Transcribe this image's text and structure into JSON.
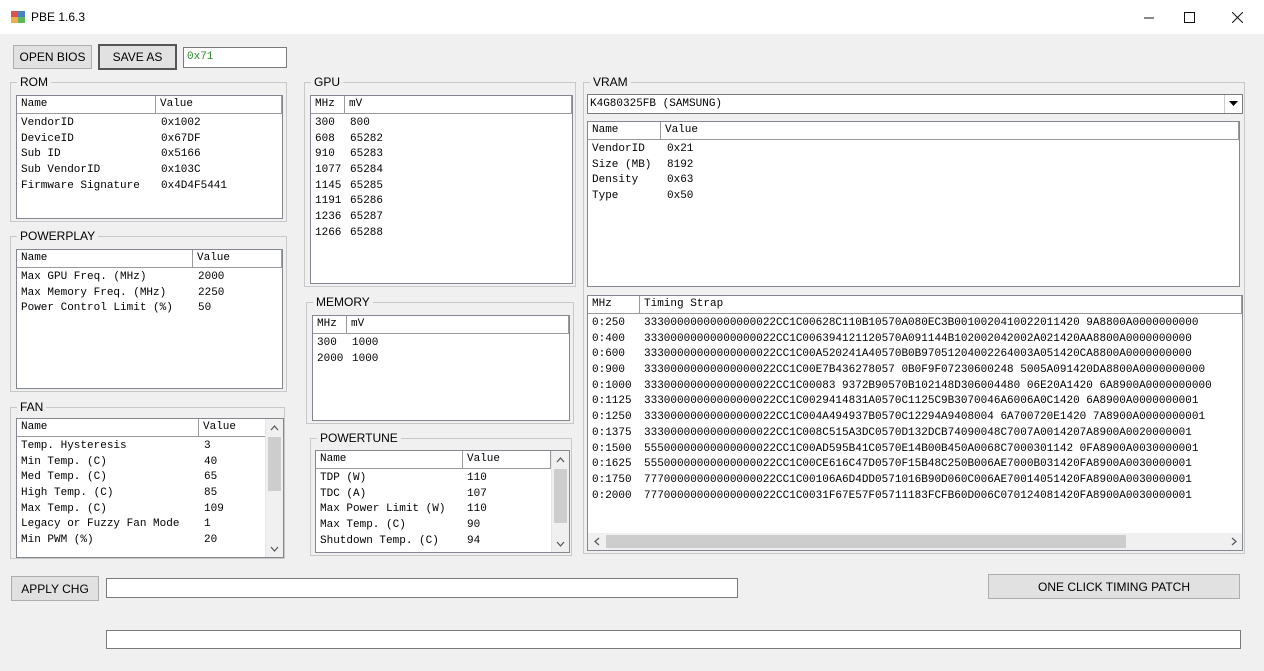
{
  "window": {
    "title": "PBE 1.6.3",
    "minimize": "—",
    "maximize": "☐",
    "close": "✕"
  },
  "toolbar": {
    "open_bios": "OPEN BIOS",
    "save_as": "SAVE AS",
    "hex_value": "0x71"
  },
  "rom": {
    "title": "ROM",
    "columns": [
      "Name",
      "Value"
    ],
    "rows": [
      [
        "VendorID",
        "0x1002"
      ],
      [
        "DeviceID",
        "0x67DF"
      ],
      [
        "Sub ID",
        "0x5166"
      ],
      [
        "Sub VendorID",
        "0x103C"
      ],
      [
        "Firmware Signature",
        "0x4D4F5441"
      ]
    ]
  },
  "powerplay": {
    "title": "POWERPLAY",
    "columns": [
      "Name",
      "Value"
    ],
    "rows": [
      [
        "Max GPU Freq. (MHz)",
        "2000"
      ],
      [
        "Max Memory Freq. (MHz)",
        "2250"
      ],
      [
        "Power Control Limit (%)",
        "50"
      ]
    ]
  },
  "fan": {
    "title": "FAN",
    "columns": [
      "Name",
      "Value"
    ],
    "rows": [
      [
        "Temp. Hysteresis",
        "3"
      ],
      [
        "Min Temp. (C)",
        "40"
      ],
      [
        "Med Temp. (C)",
        "65"
      ],
      [
        "High Temp. (C)",
        "85"
      ],
      [
        "Max Temp. (C)",
        "109"
      ],
      [
        "Legacy or Fuzzy Fan Mode",
        "1"
      ],
      [
        "Min PWM (%)",
        "20"
      ]
    ]
  },
  "gpu": {
    "title": "GPU",
    "columns": [
      "MHz",
      "mV"
    ],
    "rows": [
      [
        "300",
        "800"
      ],
      [
        "608",
        "65282"
      ],
      [
        "910",
        "65283"
      ],
      [
        "1077",
        "65284"
      ],
      [
        "1145",
        "65285"
      ],
      [
        "1191",
        "65286"
      ],
      [
        "1236",
        "65287"
      ],
      [
        "1266",
        "65288"
      ]
    ]
  },
  "memory": {
    "title": "MEMORY",
    "columns": [
      "MHz",
      "mV"
    ],
    "rows": [
      [
        "300",
        "1000"
      ],
      [
        "2000",
        "1000"
      ]
    ]
  },
  "powertune": {
    "title": "POWERTUNE",
    "columns": [
      "Name",
      "Value"
    ],
    "rows": [
      [
        "TDP (W)",
        "110"
      ],
      [
        "TDC (A)",
        "107"
      ],
      [
        "Max Power Limit (W)",
        "110"
      ],
      [
        "Max Temp. (C)",
        "90"
      ],
      [
        "Shutdown Temp. (C)",
        "94"
      ]
    ]
  },
  "vram": {
    "title": "VRAM",
    "selected_chip": "K4G80325FB (SAMSUNG)",
    "info_columns": [
      "Name",
      "Value"
    ],
    "info_rows": [
      [
        "VendorID",
        "0x21"
      ],
      [
        "Size (MB)",
        "8192"
      ],
      [
        "Density",
        "0x63"
      ],
      [
        "Type",
        "0x50"
      ]
    ],
    "timing_columns": [
      "MHz",
      "Timing Strap"
    ],
    "timing_rows": [
      [
        "0:250",
        "33300000000000000022CC1C00628C110B10570A080EC3B0010020410022011420 9A8800A0000000000"
      ],
      [
        "0:400",
        "33300000000000000022CC1C006394121120570A091144B102002042002A021420AA8800A0000000000"
      ],
      [
        "0:600",
        "33300000000000000022CC1C00A520241A40570B0B97051204002264003A051420CA8800A0000000000"
      ],
      [
        "0:900",
        "33300000000000000022CC1C00E7B436278057 0B0F9F07230600248 5005A091420DA8800A0000000000"
      ],
      [
        "0:1000",
        "33300000000000000022CC1C00083 9372B90570B102148D306004480 06E20A1420 6A8900A0000000000"
      ],
      [
        "0:1125",
        "33300000000000000022CC1C0029414831A0570C1125C9B3070046A6006A0C1420 6A8900A0000000001"
      ],
      [
        "0:1250",
        "33300000000000000022CC1C004A494937B0570C12294A9408004 6A700720E1420 7A8900A0000000001"
      ],
      [
        "0:1375",
        "33300000000000000022CC1C008C515A3DC0570D132DCB74090048C7007A0014207A8900A0020000001"
      ],
      [
        "0:1500",
        "55500000000000000022CC1C00AD595B41C0570E14B00B450A0068C7000301142 0FA8900A0030000001"
      ],
      [
        "0:1625",
        "55500000000000000022CC1C00CE616C47D0570F15B48C250B006AE7000B031420FA8900A0030000001"
      ],
      [
        "0:1750",
        "77700000000000000022CC1C00106A6D4DD0571016B90D060C006AE70014051420FA8900A0030000001"
      ],
      [
        "0:2000",
        "77700000000000000022CC1C0031F67E57F05711183FCFB60D006C070124081420FA8900A0030000001"
      ]
    ]
  },
  "bottom": {
    "apply": "APPLY CHG",
    "one_click": "ONE CLICK TIMING PATCH"
  }
}
